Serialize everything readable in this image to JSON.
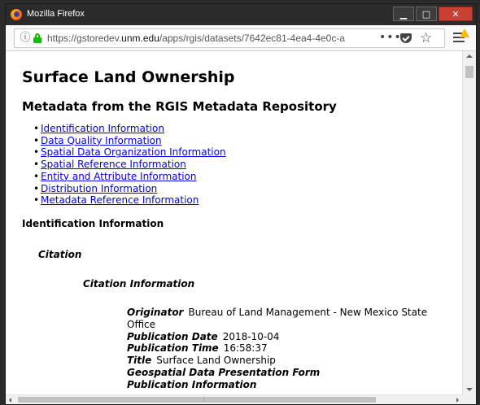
{
  "window": {
    "title": "Mozilla Firefox",
    "minimize_glyph": "▁",
    "maximize_glyph": "□",
    "close_glyph": "✕"
  },
  "toolbar": {
    "url_prefix": "https://gstoredev.",
    "url_domain": "unm.edu",
    "url_path": "/apps/rgis/datasets/7642ec81-4ea4-4e0c-a",
    "more_glyph": "•••",
    "star_glyph": "☆",
    "info_glyph": "ⓘ",
    "lock_color": "#12bc00"
  },
  "page": {
    "title": "Surface Land Ownership",
    "subtitle": "Metadata from the RGIS Metadata Repository",
    "toc": [
      "Identification Information",
      "Data Quality Information",
      "Spatial Data Organization Information",
      "Spatial Reference Information",
      "Entity and Attribute Information",
      "Distribution Information",
      "Metadata Reference Information"
    ],
    "section_title": "Identification Information",
    "citation_heading": "Citation",
    "citation_info_heading": "Citation Information",
    "fields": {
      "originator_label": "Originator",
      "originator_value": "Bureau of Land Management - New Mexico State Office",
      "pub_date_label": "Publication Date",
      "pub_date_value": "2018-10-04",
      "pub_time_label": "Publication Time",
      "pub_time_value": "16:58:37",
      "title_label": "Title",
      "title_value": "Surface Land Ownership",
      "geo_form_label": "Geospatial Data Presentation Form",
      "pub_info_label": "Publication Information"
    }
  },
  "link_color": "#0000ee"
}
